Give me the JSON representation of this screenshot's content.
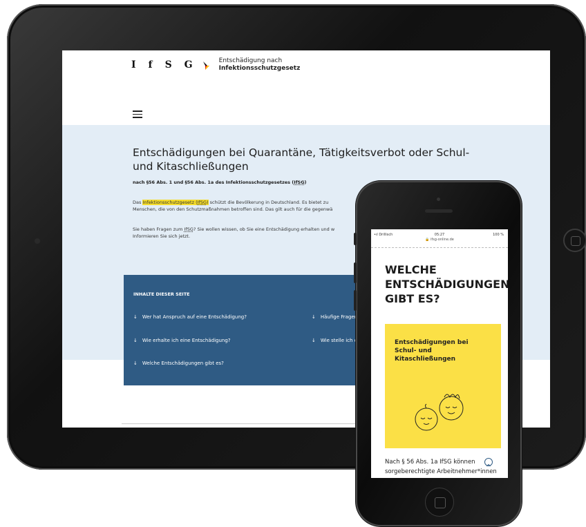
{
  "tablet": {
    "logo_letters": "IfSG",
    "logo_line1": "Entschädigung nach",
    "logo_line2": "Infektionsschutzgesetz",
    "hero": {
      "title": "Entschädigungen bei Quarantäne, Tätigkeitsverbot oder Schul- und Kitaschließungen",
      "subtitle_a": "nach §56 Abs. 1 und §56 Abs. 1a des Infektionsschutzgesetzes (",
      "subtitle_abbr": "IfSG",
      "subtitle_b": ")",
      "p1_a": "Das ",
      "p1_link": "Infektionsschutzgesetz (",
      "p1_abbr": "IfSG",
      "p1_link_end": ")",
      "p1_b": " schützt die Bevölkerung in Deutschland. Es bietet zu",
      "p1_c": "Menschen, die von den Schutzmaßnahmen betroffen sind. Das gilt auch für die gegenwä",
      "p2_a": "Sie haben Fragen zum ",
      "p2_abbr": "IfSG",
      "p2_b": "? Sie wollen wissen, ob Sie eine Entschädigung erhalten und w",
      "p2_c": "Informieren Sie sich jetzt."
    },
    "toc": {
      "title": "INHALTE DIESER SEITE",
      "items": [
        "Wer hat Anspruch auf eine Entschädigung?",
        "Häufige Fragen",
        "Wie erhalte ich eine Entschädigung?",
        "Wie stelle ich de",
        "Welche Entschädigungen gibt es?"
      ],
      "arrow": "↓"
    }
  },
  "phone": {
    "status": {
      "carrier": "•ıl Drillisch",
      "time": "05:27",
      "battery": "100 %"
    },
    "url": "ifsg-online.de",
    "heading": "WELCHE ENTSCHÄDIGUNGEN GIBT ES?",
    "card_title": "Entschädigungen bei Schul- und Kitaschließungen",
    "body": "Nach § 56 Abs. 1a IfSG können sorgeberechtigte Arbeitnehmer*innen"
  },
  "colors": {
    "accent_blue": "#2f5b84",
    "highlight_yellow": "#f5dc2b",
    "card_yellow": "#fbe046",
    "hero_bg": "#e3edf6"
  }
}
